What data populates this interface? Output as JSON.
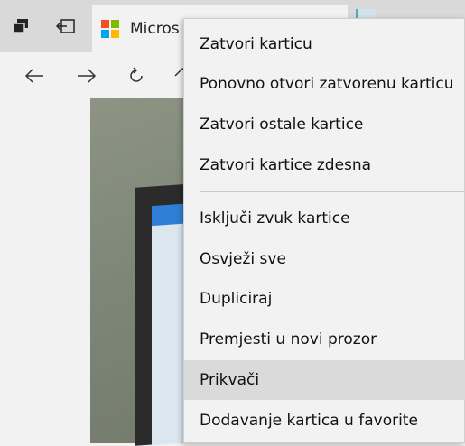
{
  "tab": {
    "title": "Micros"
  },
  "icons": {
    "tab_actions": "tab-actions-icon",
    "set_aside": "set-aside-tabs-icon",
    "back": "back-arrow-icon",
    "forward": "forward-arrow-icon",
    "refresh": "refresh-icon",
    "home": "home-icon"
  },
  "colors": {
    "ms_red": "#f25022",
    "ms_green": "#7fba00",
    "ms_blue": "#00a4ef",
    "ms_yellow": "#ffb900",
    "menu_bg": "#f2f2f2",
    "hover": "#dadada"
  },
  "menu": {
    "items": [
      {
        "label": "Zatvori karticu"
      },
      {
        "label": "Ponovno otvori zatvorenu karticu"
      },
      {
        "label": "Zatvori ostale kartice"
      },
      {
        "label": "Zatvori kartice zdesna"
      },
      {
        "label": "Isključi zvuk kartice"
      },
      {
        "label": "Osvježi sve"
      },
      {
        "label": "Dupliciraj"
      },
      {
        "label": "Premjesti u novi prozor"
      },
      {
        "label": "Prikvači"
      },
      {
        "label": "Dodavanje kartica u favorite"
      }
    ]
  }
}
